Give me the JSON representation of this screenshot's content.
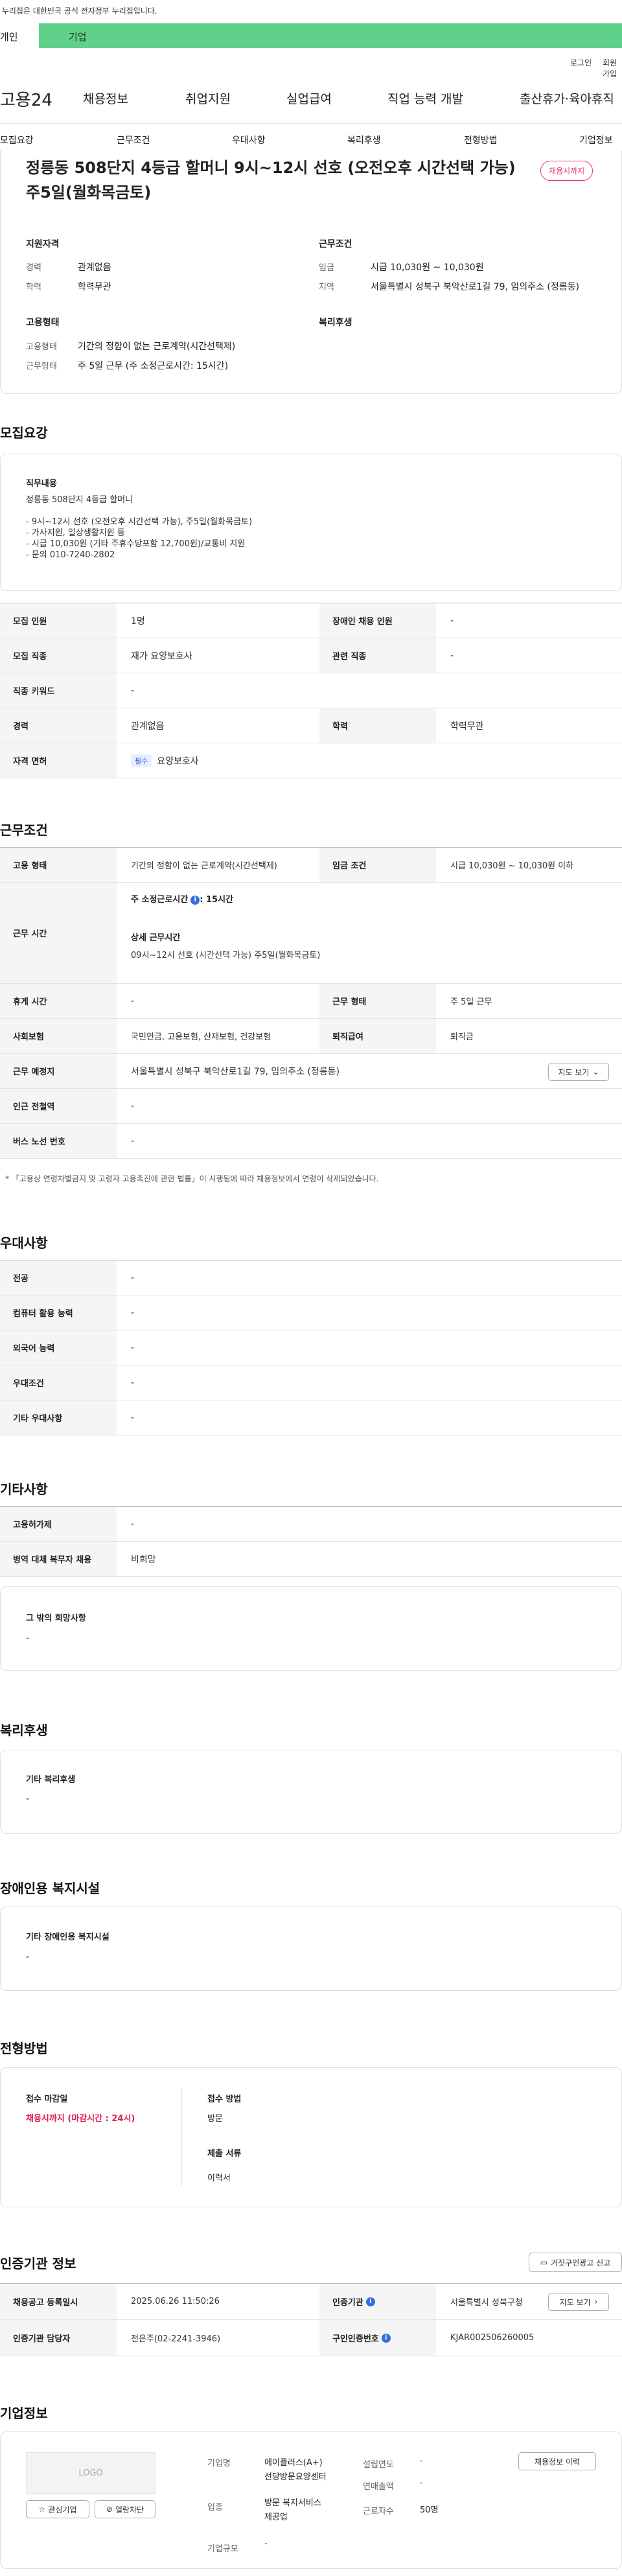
{
  "gov_banner": {
    "text": "이 누리집은 대한민국 공식 전자정부 누리집입니다."
  },
  "tabs": {
    "individual": "개인",
    "business": "기업"
  },
  "util": {
    "login": "로그인",
    "join": "회원가입"
  },
  "logo": "고용24",
  "gnb": [
    "채용정보",
    "취업지원",
    "실업급여",
    "직업 능력 개발",
    "출산휴가·육아휴직"
  ],
  "snb": [
    "모집요강",
    "근무조건",
    "우대사항",
    "복리후생",
    "전형방법",
    "기업정보"
  ],
  "job": {
    "title_line1": "정릉동 508단지 4등급 할머니 9시~12시 선호 (오전오후 시간선택 가능)",
    "title_line2": "주5일(월화목금토)",
    "deadline_badge": "채용시까지",
    "qual_title": "지원자격",
    "career_label": "경력",
    "career": "관계없음",
    "edu_label": "학력",
    "edu": "학력무관",
    "emp_title": "고용형태",
    "emp_label": "고용형태",
    "emp": "기간의 정함이 없는 근로계약(시간선택제)",
    "worktype_label": "근무형태",
    "worktype": "주 5일 근무 (주 소정근로시간: 15시간)",
    "cond_title": "근무조건",
    "wage_label": "임금",
    "wage": "시급 10,030원 ~ 10,030원",
    "region_label": "지역",
    "region": "서울특별시 성북구 북악산로1길 79, 임의주소 (정릉동)",
    "welfare_title": "복리후생"
  },
  "recruit": {
    "title": "모집요강",
    "duty_title": "직무내용",
    "duty_lines": [
      "정릉동 508단지 4등급 할머니",
      "",
      "- 9시~12시 선호 (오전오후 시간선택 가능), 주5일(월화목금토)",
      "- 가사지원, 일상생활지원 등",
      "- 시급 10,030원 (기타 주휴수당포함 12,700원)/교통비 지원",
      "- 문의 010-7240-2802"
    ],
    "rows": [
      {
        "k1": "모집 인원",
        "v1": "1명",
        "k2": "장애인 채용 인원",
        "v2": "-"
      },
      {
        "k1": "모집 직종",
        "v1": "재가 요양보호사",
        "k2": "관련 직종",
        "v2": "-"
      },
      {
        "k1": "직종 키워드",
        "v1": "-"
      },
      {
        "k1": "경력",
        "v1": "관계없음",
        "k2": "학력",
        "v2": "학력무관"
      },
      {
        "k1": "자격 면허",
        "chip": "필수",
        "v1": "요양보호사"
      }
    ]
  },
  "conditions": {
    "title": "근무조건",
    "emp_k": "고용 형태",
    "emp_v": "기간의 정함이 없는 근로계약(시간선택제)",
    "wage_k": "임금 조건",
    "wage_v": "시급 10,030원 ~ 10,030원 이하",
    "hours_k": "근무 시간",
    "hours_week": "주 소정근로시간",
    "hours_week_v": ": 15시간",
    "hours_detail_label": "상세 근무시간",
    "hours_detail": "09시~12시 선호 (시간선택 가능) 주5일(월화목금토)",
    "break_k": "휴게 시간",
    "break_v": "-",
    "work_k": "근무 형태",
    "work_v": "주 5일 근무",
    "ins_k": "사회보험",
    "ins_v": "국민연금, 고용보험, 산재보험, 건강보험",
    "ret_k": "퇴직급여",
    "ret_v": "퇴직금",
    "place_k": "근무 예정지",
    "place_v": "서울특별시 성북구 북악산로1길 79, 임의주소 (정릉동)",
    "map_btn": "지도 보기",
    "subway_k": "인근 전철역",
    "subway_v": "-",
    "bus_k": "버스 노선 번호",
    "bus_v": "-",
    "note": "* 「고용상 연령차별금지 및 고령자 고용촉진에 관한 법률」이 시행됨에 따라 채용정보에서 연령이 삭제되었습니다."
  },
  "pref": {
    "title": "우대사항",
    "rows": [
      {
        "k": "전공",
        "v": "-"
      },
      {
        "k": "컴퓨터 활용 능력",
        "v": "-"
      },
      {
        "k": "외국어 능력",
        "v": "-"
      },
      {
        "k": "우대조건",
        "v": "-"
      },
      {
        "k": "기타 우대사항",
        "v": "-"
      }
    ]
  },
  "etc": {
    "title": "기타사항",
    "rows": [
      {
        "k": "고용허가제",
        "v": "-"
      },
      {
        "k": "병역 대체 복무자 채용",
        "v": "비희망"
      }
    ],
    "other_title": "그 밖의 희망사항",
    "other_v": "-"
  },
  "welfare": {
    "title": "복리후생",
    "box_title": "기타 복리후생",
    "box_v": "-"
  },
  "disability": {
    "title": "장애인용 복지시설",
    "box_title": "기타 장애인용 복지시설",
    "box_v": "-"
  },
  "selection": {
    "title": "전형방법",
    "deadline_label": "접수 마감일",
    "deadline_v": "채용시까지 (마감시간 : 24시)",
    "method_label": "접수 방법",
    "method_v": "방문",
    "docs_label": "제출 서류",
    "docs_v": "이력서"
  },
  "agency": {
    "title": "인증기관 정보",
    "report_btn": "거짓구인광고 신고",
    "reg_k": "채용공고 등록일시",
    "reg_v": "2025.06.26 11:50:26",
    "org_k": "인증기관",
    "org_v": "서울특별시 성북구청",
    "map_btn": "지도 보기",
    "mgr_k": "인증기관 담당자",
    "mgr_v": "전은주(02-2241-3946)",
    "id_k": "구인인증번호",
    "id_v": "KJAR002506260005"
  },
  "company": {
    "title": "기업정보",
    "logo": "LOGO",
    "fav_btn": "관심기업",
    "block_btn": "열람차단",
    "hist_btn": "채용정보 이력",
    "name_k": "기업명",
    "name_v1": "에이플러스(A+)",
    "name_v2": "선당방문요양센터",
    "biz_k": "업종",
    "biz_v1": "방문 복지서비스",
    "biz_v2": "제공업",
    "size_k": "기업규모",
    "size_v": "-",
    "year_k": "설립연도",
    "year_v": "-",
    "sales_k": "연매출액",
    "sales_v": "-",
    "emp_k": "근로자수",
    "emp_v": "50명"
  }
}
